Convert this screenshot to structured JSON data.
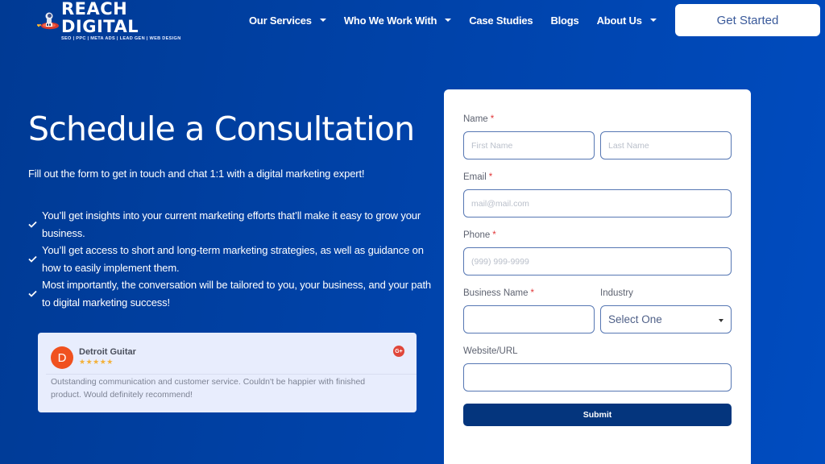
{
  "brand": {
    "name": "REACH DIGITAL",
    "tagline": "SEO | PPC | META ADS | LEAD GEN | WEB DESIGN",
    "logo_icon": "rocket-astronaut-icon"
  },
  "nav": {
    "items": [
      {
        "label": "Our Services",
        "has_dropdown": true
      },
      {
        "label": "Who We Work With",
        "has_dropdown": true
      },
      {
        "label": "Case Studies",
        "has_dropdown": false
      },
      {
        "label": "Blogs",
        "has_dropdown": false
      },
      {
        "label": "About Us",
        "has_dropdown": true
      }
    ],
    "cta_label": "Get Started"
  },
  "hero": {
    "title": "Schedule a Consultation",
    "subtitle": "Fill out the form to get in touch and chat 1:1 with a digital marketing expert!",
    "benefits": [
      "You’ll get insights into your current marketing efforts that’ll make it easy to grow your business.",
      "You’ll get access to short and long-term marketing strategies, as well as guidance on how to easily implement them.",
      "Most importantly, the conversation will be tailored to you, your business, and your path to digital marketing success!"
    ]
  },
  "review": {
    "avatar_letter": "D",
    "reviewer": "Detroit Guitar",
    "rating": 5,
    "stars": "★★★★★",
    "source_icon": "G+",
    "text": "Outstanding communication and customer service. Couldn't be happier with finished product. Would definitely recommend!"
  },
  "form": {
    "name": {
      "label": "Name",
      "required_mark": "*",
      "first_placeholder": "First Name",
      "last_placeholder": "Last Name",
      "first_value": "",
      "last_value": ""
    },
    "email": {
      "label": "Email",
      "required_mark": "*",
      "placeholder": "mail@mail.com",
      "value": ""
    },
    "phone": {
      "label": "Phone",
      "required_mark": "*",
      "placeholder": "(999) 999-9999",
      "value": ""
    },
    "business": {
      "label": "Business Name",
      "required_mark": "*",
      "placeholder": "",
      "value": ""
    },
    "industry": {
      "label": "Industry",
      "selected": "Select One"
    },
    "website": {
      "label": "Website/URL",
      "placeholder": "",
      "value": ""
    },
    "submit_label": "Submit"
  },
  "colors": {
    "bg_left": "#003a94",
    "bg_right": "#004cc0",
    "submit": "#04357d",
    "input_border": "#5677b3",
    "required": "#e2383a",
    "avatar": "#f0511f",
    "stars": "#f3b13a",
    "review_bg": "#e8edfd"
  }
}
